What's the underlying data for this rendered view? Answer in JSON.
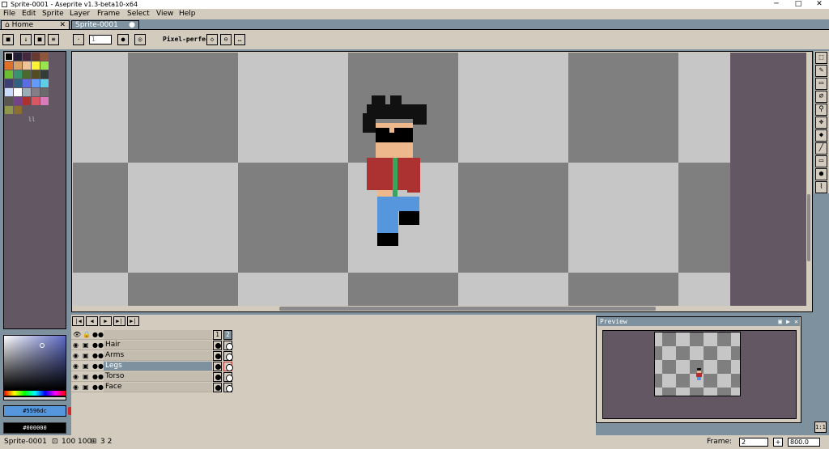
{
  "window": {
    "title": "Sprite-0001 - Aseprite v1.3-beta10-x64",
    "minimize": "─",
    "maximize": "□",
    "close": "✕"
  },
  "menu": [
    "File",
    "Edit",
    "Sprite",
    "Layer",
    "Frame",
    "Select",
    "View",
    "Help"
  ],
  "tabs": {
    "home": "Home",
    "home_close": "✕",
    "sprite": "Sprite-0001",
    "sprite_dot": "●"
  },
  "context_bar": {
    "brush_size": "1",
    "pixel_perfect_label": "Pixel-perfect"
  },
  "palette": {
    "colors": [
      "#000000",
      "#222034",
      "#45283c",
      "#663931",
      "#8f563b",
      "#df7126",
      "#d9a066",
      "#eec39a",
      "#fbf236",
      "#99e550",
      "#6abe30",
      "#37946e",
      "#4b692f",
      "#524b24",
      "#323c39",
      "#3f3f74",
      "#306082",
      "#5b6ee1",
      "#639bff",
      "#5fcde4",
      "#cbdbfc",
      "#ffffff",
      "#9badb7",
      "#847e87",
      "#696a6a",
      "#595652",
      "#76428a",
      "#ac3232",
      "#d95763",
      "#d77bba",
      "#8f974a",
      "#8a6f30"
    ],
    "index_marker": "ll"
  },
  "colors": {
    "foreground": "#5596dc",
    "background": "#000000",
    "accent": "#7d929e",
    "canvas_bg": "#635764"
  },
  "timeline": {
    "header_frames": [
      "1",
      "2"
    ],
    "layers": [
      {
        "name": "Hair",
        "selected": false
      },
      {
        "name": "Arms",
        "selected": false
      },
      {
        "name": "Legs",
        "selected": true
      },
      {
        "name": "Torso",
        "selected": false
      },
      {
        "name": "Face",
        "selected": false
      }
    ],
    "play_buttons": [
      "|◀",
      "◀",
      "▶",
      "▶|",
      "▶|"
    ]
  },
  "preview": {
    "title": "Preview"
  },
  "status": {
    "sprite": "Sprite-0001",
    "size": "100 100",
    "frame_info": "3 2",
    "frame_label": "Frame:",
    "frame_value": "2",
    "plus": "+",
    "zoom": "800.0"
  },
  "tools": [
    "rectangular-marquee",
    "pencil",
    "eraser",
    "eyedropper",
    "zoom",
    "move",
    "paint-bucket",
    "line",
    "rectangle",
    "ellipse-fill",
    "blur"
  ]
}
